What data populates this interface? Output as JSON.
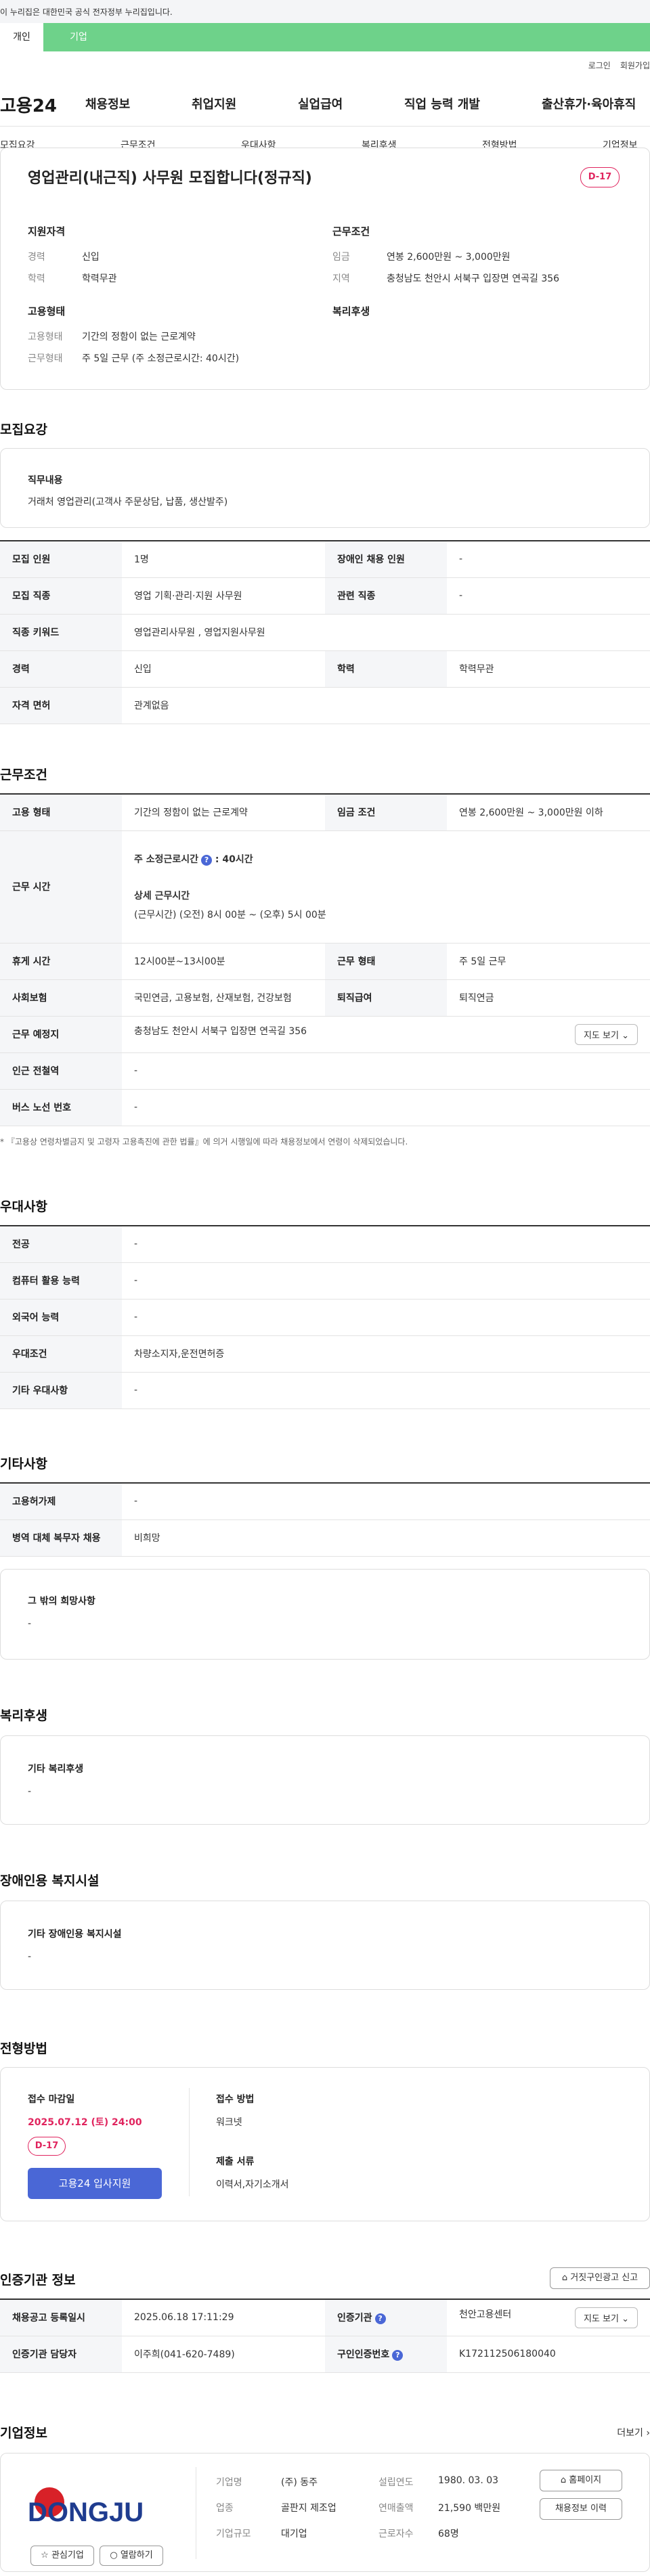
{
  "gov_banner": "이 누리집은 대한민국 공식 전자정부 누리집입니다.",
  "user_tabs": [
    "개인",
    "기업"
  ],
  "top_links": [
    "로그인",
    "회원가입"
  ],
  "logo": "고용24",
  "gnb": [
    "채용정보",
    "취업지원",
    "실업급여",
    "직업 능력 개발",
    "출산휴가·육아휴직"
  ],
  "anchors": [
    "모집요강",
    "근무조건",
    "우대사항",
    "복리후생",
    "전형방법",
    "기업정보"
  ],
  "job": {
    "title": "영업관리(내근직) 사무원 모집합니다(정규직)",
    "dday": "D-17",
    "req_title": "지원자격",
    "cond_title": "근무조건",
    "emp_title": "고용형태",
    "welfare_title": "복리후생",
    "career_k": "경력",
    "career_v": "신입",
    "edu_k": "학력",
    "edu_v": "학력무관",
    "wage_k": "임금",
    "wage_v": "연봉 2,600만원 ~ 3,000만원",
    "area_k": "지역",
    "area_v": "충청남도 천안시 서북구 입장면 연곡길 356",
    "type_k": "고용형태",
    "type_v": "기간의 정함이 없는 근로계약",
    "form_k": "근무형태",
    "form_v": "주 5일 근무 (주 소정근로시간: 40시간)"
  },
  "recruit": {
    "title": "모집요강",
    "duty_title": "직무내용",
    "duty_text": "거래처 영업관리(고객사 주문상담, 납품, 생산발주)",
    "rows": [
      [
        "모집 인원",
        "1명",
        "장애인 채용 인원",
        "-"
      ],
      [
        "모집 직종",
        "영업 기획·관리·지원 사무원",
        "관련 직종",
        "-"
      ],
      [
        "직종 키워드",
        "영업관리사무원 , 영업지원사무원"
      ],
      [
        "경력",
        "신입",
        "학력",
        "학력무관"
      ],
      [
        "자격 면허",
        "관계없음"
      ]
    ]
  },
  "work": {
    "title": "근무조건",
    "r1": [
      "고용 형태",
      "기간의 정함이 없는 근로계약",
      "임금 조건",
      "연봉 2,600만원 ~ 3,000만원 이하"
    ],
    "hours_k": "근무 시간",
    "hours_a": "주 소정근로시간",
    "hours_b": ": 40시간",
    "hours_c": "상세 근무시간",
    "hours_d": "(근무시간) (오전) 8시 00분 ~ (오후) 5시 00분",
    "r3": [
      "휴게 시간",
      "12시00분~13시00분",
      "근무 형태",
      "주 5일 근무"
    ],
    "r4": [
      "사회보험",
      "국민연금, 고용보험, 산재보험, 건강보험",
      "퇴직급여",
      "퇴직연금"
    ],
    "place_k": "근무 예정지",
    "place_v": "충청남도 천안시 서북구 입장면 연곡길 356",
    "map_btn": "지도 보기",
    "r6": [
      "인근 전철역",
      "-"
    ],
    "r7": [
      "버스 노선 번호",
      "-"
    ],
    "note": "* 『고용상 연령차별금지 및 고령자 고용촉진에 관한 법률』에 의거 시행일에 따라 채용정보에서 연령이 삭제되었습니다."
  },
  "pref": {
    "title": "우대사항",
    "rows": [
      [
        "전공",
        "-"
      ],
      [
        "컴퓨터 활용 능력",
        "-"
      ],
      [
        "외국어 능력",
        "-"
      ],
      [
        "우대조건",
        "차량소지자,운전면허증"
      ],
      [
        "기타 우대사항",
        "-"
      ]
    ]
  },
  "etc": {
    "title": "기타사항",
    "rows": [
      [
        "고용허가제",
        "-"
      ],
      [
        "병역 대체 복무자 채용",
        "비희망"
      ]
    ],
    "box_title": "그 밖의 희망사항",
    "box_value": "-"
  },
  "welfare": {
    "title": "복리후생",
    "box_title": "기타 복리후생",
    "box_value": "-"
  },
  "disabled": {
    "title": "장애인용 복지시설",
    "box_title": "기타 장애인용 복지시설",
    "box_value": "-"
  },
  "selection": {
    "title": "전형방법",
    "deadline_k": "접수 마감일",
    "deadline_v": "2025.07.12 (토) 24:00",
    "dday": "D-17",
    "apply": "고용24 입사지원",
    "method_k": "접수 방법",
    "method_v": "워크넷",
    "docs_k": "제출 서류",
    "docs_v": "이력서,자기소개서"
  },
  "cert": {
    "title": "인증기관 정보",
    "report_btn": "거짓구인광고 신고",
    "r1": [
      "채용공고 등록일시",
      "2025.06.18 17:11:29",
      "인증기관",
      "천안고용센터"
    ],
    "map_btn": "지도 보기",
    "r2": [
      "인증기관 담당자",
      "이주희(041-620-7489)",
      "구인인증번호",
      "K172112506180040"
    ]
  },
  "company": {
    "title": "기업정보",
    "more": "더보기",
    "logo_text": "DONGJU",
    "fields": [
      [
        "기업명",
        "(주) 동주"
      ],
      [
        "업종",
        "골판지 제조업"
      ],
      [
        "기업규모",
        "대기업"
      ]
    ],
    "fields2": [
      [
        "설립연도",
        "1980. 03. 03"
      ],
      [
        "연매출액",
        "21,590 백만원"
      ],
      [
        "근로자수",
        "68명"
      ]
    ],
    "btn_home": "홈페이지",
    "btn_history": "채용정보 이력",
    "btn_fav": "관심기업",
    "btn_pop": "열람하기"
  },
  "colors": {
    "green": "#6ed28a",
    "blue": "#4a67d6",
    "red": "#e0245e"
  }
}
